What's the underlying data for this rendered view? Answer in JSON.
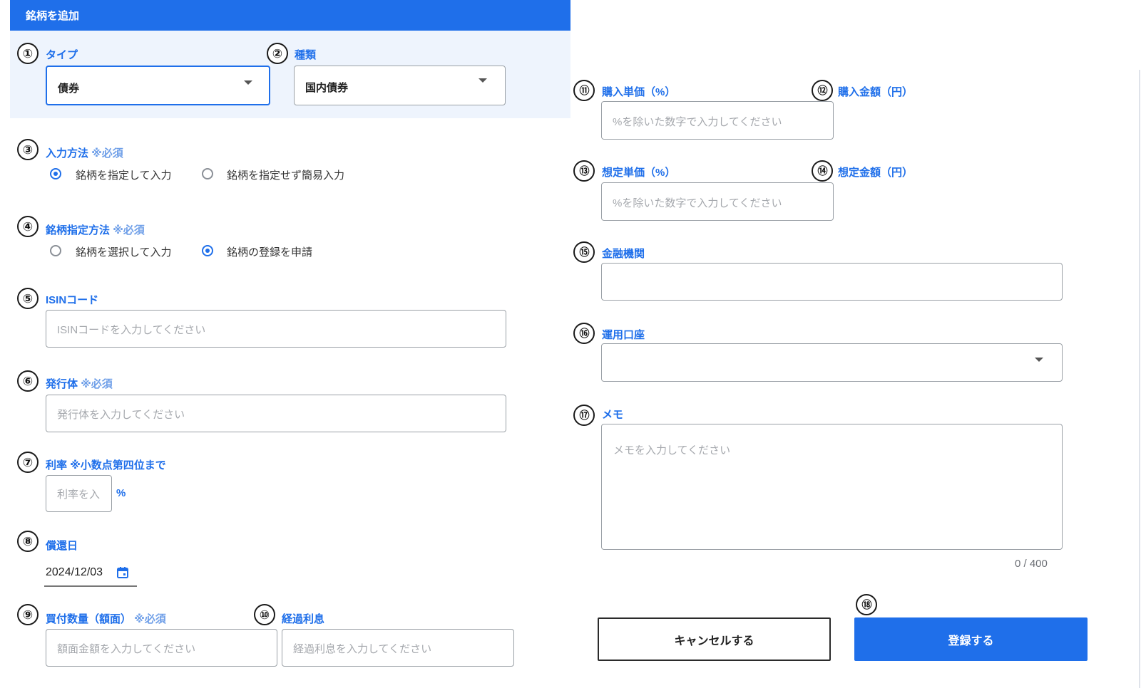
{
  "dialog": {
    "title": "銘柄を追加"
  },
  "markers": [
    "①",
    "②",
    "③",
    "④",
    "⑤",
    "⑥",
    "⑦",
    "⑧",
    "⑨",
    "⑩",
    "⑪",
    "⑫",
    "⑬",
    "⑭",
    "⑮",
    "⑯",
    "⑰",
    "⑱"
  ],
  "type_field": {
    "label": "タイプ",
    "value": "債券"
  },
  "kind_field": {
    "label": "種類",
    "value": "国内債券"
  },
  "input_method": {
    "label": "入力方法",
    "required": "※必須",
    "options": [
      "銘柄を指定して入力",
      "銘柄を指定せず簡易入力"
    ],
    "selected": "銘柄を指定して入力"
  },
  "designation_method": {
    "label": "銘柄指定方法",
    "required": "※必須",
    "options": [
      "銘柄を選択して入力",
      "銘柄の登録を申請"
    ],
    "selected": "銘柄の登録を申請"
  },
  "isin": {
    "label": "ISINコード",
    "placeholder": "ISINコードを入力してください"
  },
  "issuer": {
    "label": "発行体",
    "required": "※必須",
    "placeholder": "発行体を入力してください"
  },
  "rate": {
    "label": "利率",
    "note": "※小数点第四位まで",
    "placeholder": "利率を入",
    "unit": "%"
  },
  "redemption": {
    "label": "償還日",
    "value": "2024/12/03"
  },
  "quantity": {
    "label": "買付数量（額面）",
    "required": "※必須",
    "placeholder": "額面金額を入力してください"
  },
  "accrued": {
    "label": "経過利息",
    "placeholder": "経過利息を入力してください"
  },
  "purchase_price": {
    "label": "購入単価（%）",
    "placeholder": "%を除いた数字で入力してください"
  },
  "purchase_amount": {
    "label": "購入金額（円）"
  },
  "estimated_price": {
    "label": "想定単価（%）",
    "placeholder": "%を除いた数字で入力してください"
  },
  "estimated_amount": {
    "label": "想定金額（円）"
  },
  "institution": {
    "label": "金融機関",
    "value": ""
  },
  "account": {
    "label": "運用口座",
    "value": ""
  },
  "memo": {
    "label": "メモ",
    "placeholder": "メモを入力してください",
    "counter": "0 / 400"
  },
  "actions": {
    "cancel": "キャンセルする",
    "submit": "登録する"
  },
  "colors": {
    "accent": "#1f6fea",
    "panel": "#eef4fd",
    "border": "#9aa0a6"
  }
}
